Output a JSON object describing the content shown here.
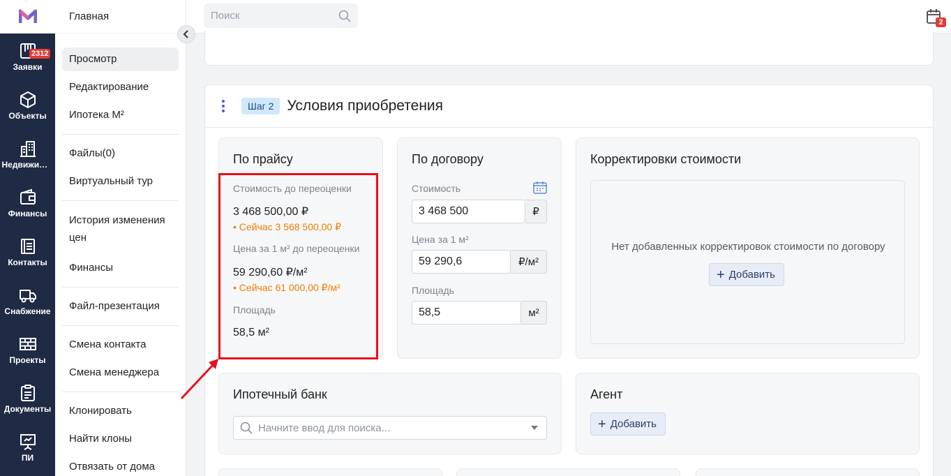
{
  "rail": {
    "items": [
      {
        "label": "Заявки",
        "icon": "requests-icon",
        "badge": "2312"
      },
      {
        "label": "Объекты",
        "icon": "cube-icon"
      },
      {
        "label": "Недвижимость",
        "icon": "building-icon"
      },
      {
        "label": "Финансы",
        "icon": "wallet-icon"
      },
      {
        "label": "Контакты",
        "icon": "contacts-icon"
      },
      {
        "label": "Снабжение",
        "icon": "truck-icon"
      },
      {
        "label": "Проекты",
        "icon": "bricks-icon"
      },
      {
        "label": "Документы",
        "icon": "clipboard-icon"
      },
      {
        "label": "ПИ",
        "icon": "presentation-icon"
      }
    ]
  },
  "menu": {
    "top": "Главная",
    "items": [
      "Просмотр",
      "Редактирование",
      "Ипотека М²",
      "Файлы(0)",
      "Виртуальный тур",
      "История изменения цен",
      "Финансы",
      "Файл-презентация",
      "Смена контакта",
      "Смена менеджера",
      "Клонировать",
      "Найти клоны",
      "Отвязать от дома"
    ]
  },
  "search": {
    "placeholder": "Поиск"
  },
  "calendar": {
    "badge": "2"
  },
  "step": {
    "badge": "Шаг 2",
    "title": "Условия приобретения"
  },
  "price_list": {
    "title": "По прайсу",
    "cost_label": "Стоимость до переоценки",
    "cost_value": "3 468 500,00 ₽",
    "cost_now": "• Сейчас 3 568 500,00 ₽",
    "per_m2_label": "Цена за 1 м² до переоценки",
    "per_m2_value": "59 290,60 ₽/м²",
    "per_m2_now": "• Сейчас 61 000,00 ₽/м²",
    "area_label": "Площадь",
    "area_value": "58,5 м²"
  },
  "contract": {
    "title": "По договору",
    "cost_label": "Стоимость",
    "cost_value": "3 468 500",
    "cost_unit": "₽",
    "per_m2_label": "Цена за 1 м²",
    "per_m2_value": "59 290,6",
    "per_m2_unit": "₽/м²",
    "area_label": "Площадь",
    "area_value": "58,5",
    "area_unit": "м²"
  },
  "adjustments": {
    "title": "Корректировки стоимости",
    "empty": "Нет добавленных корректировок стоимости по договору",
    "add": "Добавить"
  },
  "bank": {
    "title": "Ипотечный банк",
    "placeholder": "Начните ввод для поиска..."
  },
  "agent": {
    "title": "Агент",
    "add": "Добавить"
  },
  "colors": {
    "rail": "#1f2a44",
    "highlight": "#e8101a",
    "now_text": "#f07d00",
    "badge": "#e53935"
  }
}
